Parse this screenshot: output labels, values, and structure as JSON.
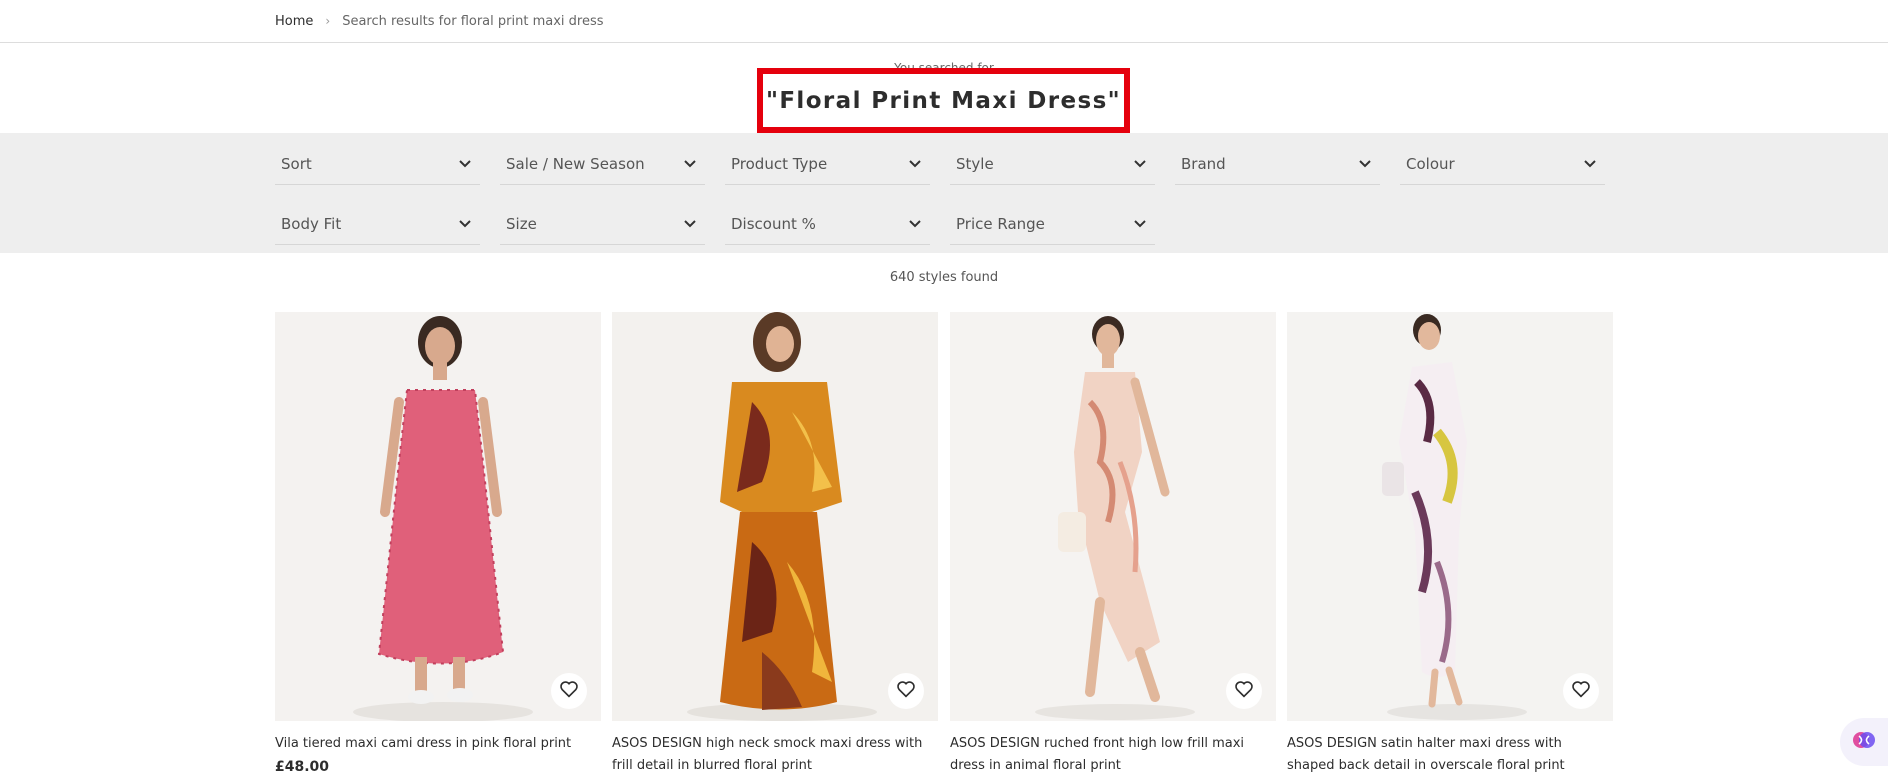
{
  "breadcrumb": {
    "home": "Home",
    "separator": "›",
    "current": "Search results for floral print maxi dress"
  },
  "search_header": {
    "subline": "You searched for",
    "title": "\"Floral Print Maxi Dress\""
  },
  "filters": [
    {
      "label": "Sort"
    },
    {
      "label": "Sale / New Season"
    },
    {
      "label": "Product Type"
    },
    {
      "label": "Style"
    },
    {
      "label": "Brand"
    },
    {
      "label": "Colour"
    },
    {
      "label": "Body Fit"
    },
    {
      "label": "Size"
    },
    {
      "label": "Discount %"
    },
    {
      "label": "Price Range"
    }
  ],
  "results_count": "640 styles found",
  "products": [
    {
      "title": "Vila tiered maxi cami dress in pink floral print",
      "price": "£48.00"
    },
    {
      "title": "ASOS DESIGN high neck smock maxi dress with frill detail in blurred floral print",
      "price": ""
    },
    {
      "title": "ASOS DESIGN ruched front high low frill maxi dress in animal floral print",
      "price": ""
    },
    {
      "title": "ASOS DESIGN satin halter maxi dress with shaped back detail in overscale floral print",
      "price": ""
    }
  ],
  "colors": {
    "highlight": "#e5000d",
    "filter_bg": "#eeeeee",
    "text": "#2d2d2d"
  },
  "icons": {
    "filter_chevron": "chevron-down-icon",
    "wishlist": "heart-icon",
    "assistant": "assistant-icon"
  }
}
